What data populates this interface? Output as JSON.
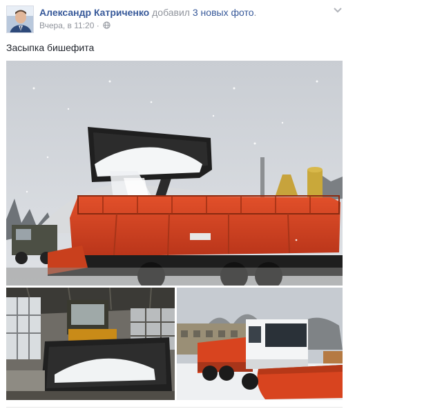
{
  "post": {
    "author_name": "Александр Катриченко",
    "action_text": "добавил",
    "photos_link": "3 новых фото",
    "period": ".",
    "timestamp": "Вчера, в 11:20",
    "separator": "·",
    "privacy_icon": "globe-icon",
    "menu_icon": "chevron-down-icon",
    "caption": "Засыпка бишефита"
  },
  "photos": [
    {
      "name": "salt-loading-truck-photo"
    },
    {
      "name": "loader-bucket-salt-photo"
    },
    {
      "name": "orange-plow-truck-photo"
    }
  ],
  "colors": {
    "link": "#365899",
    "muted": "#90949c",
    "text": "#1d2129",
    "truck_orange": "#d8401f"
  }
}
